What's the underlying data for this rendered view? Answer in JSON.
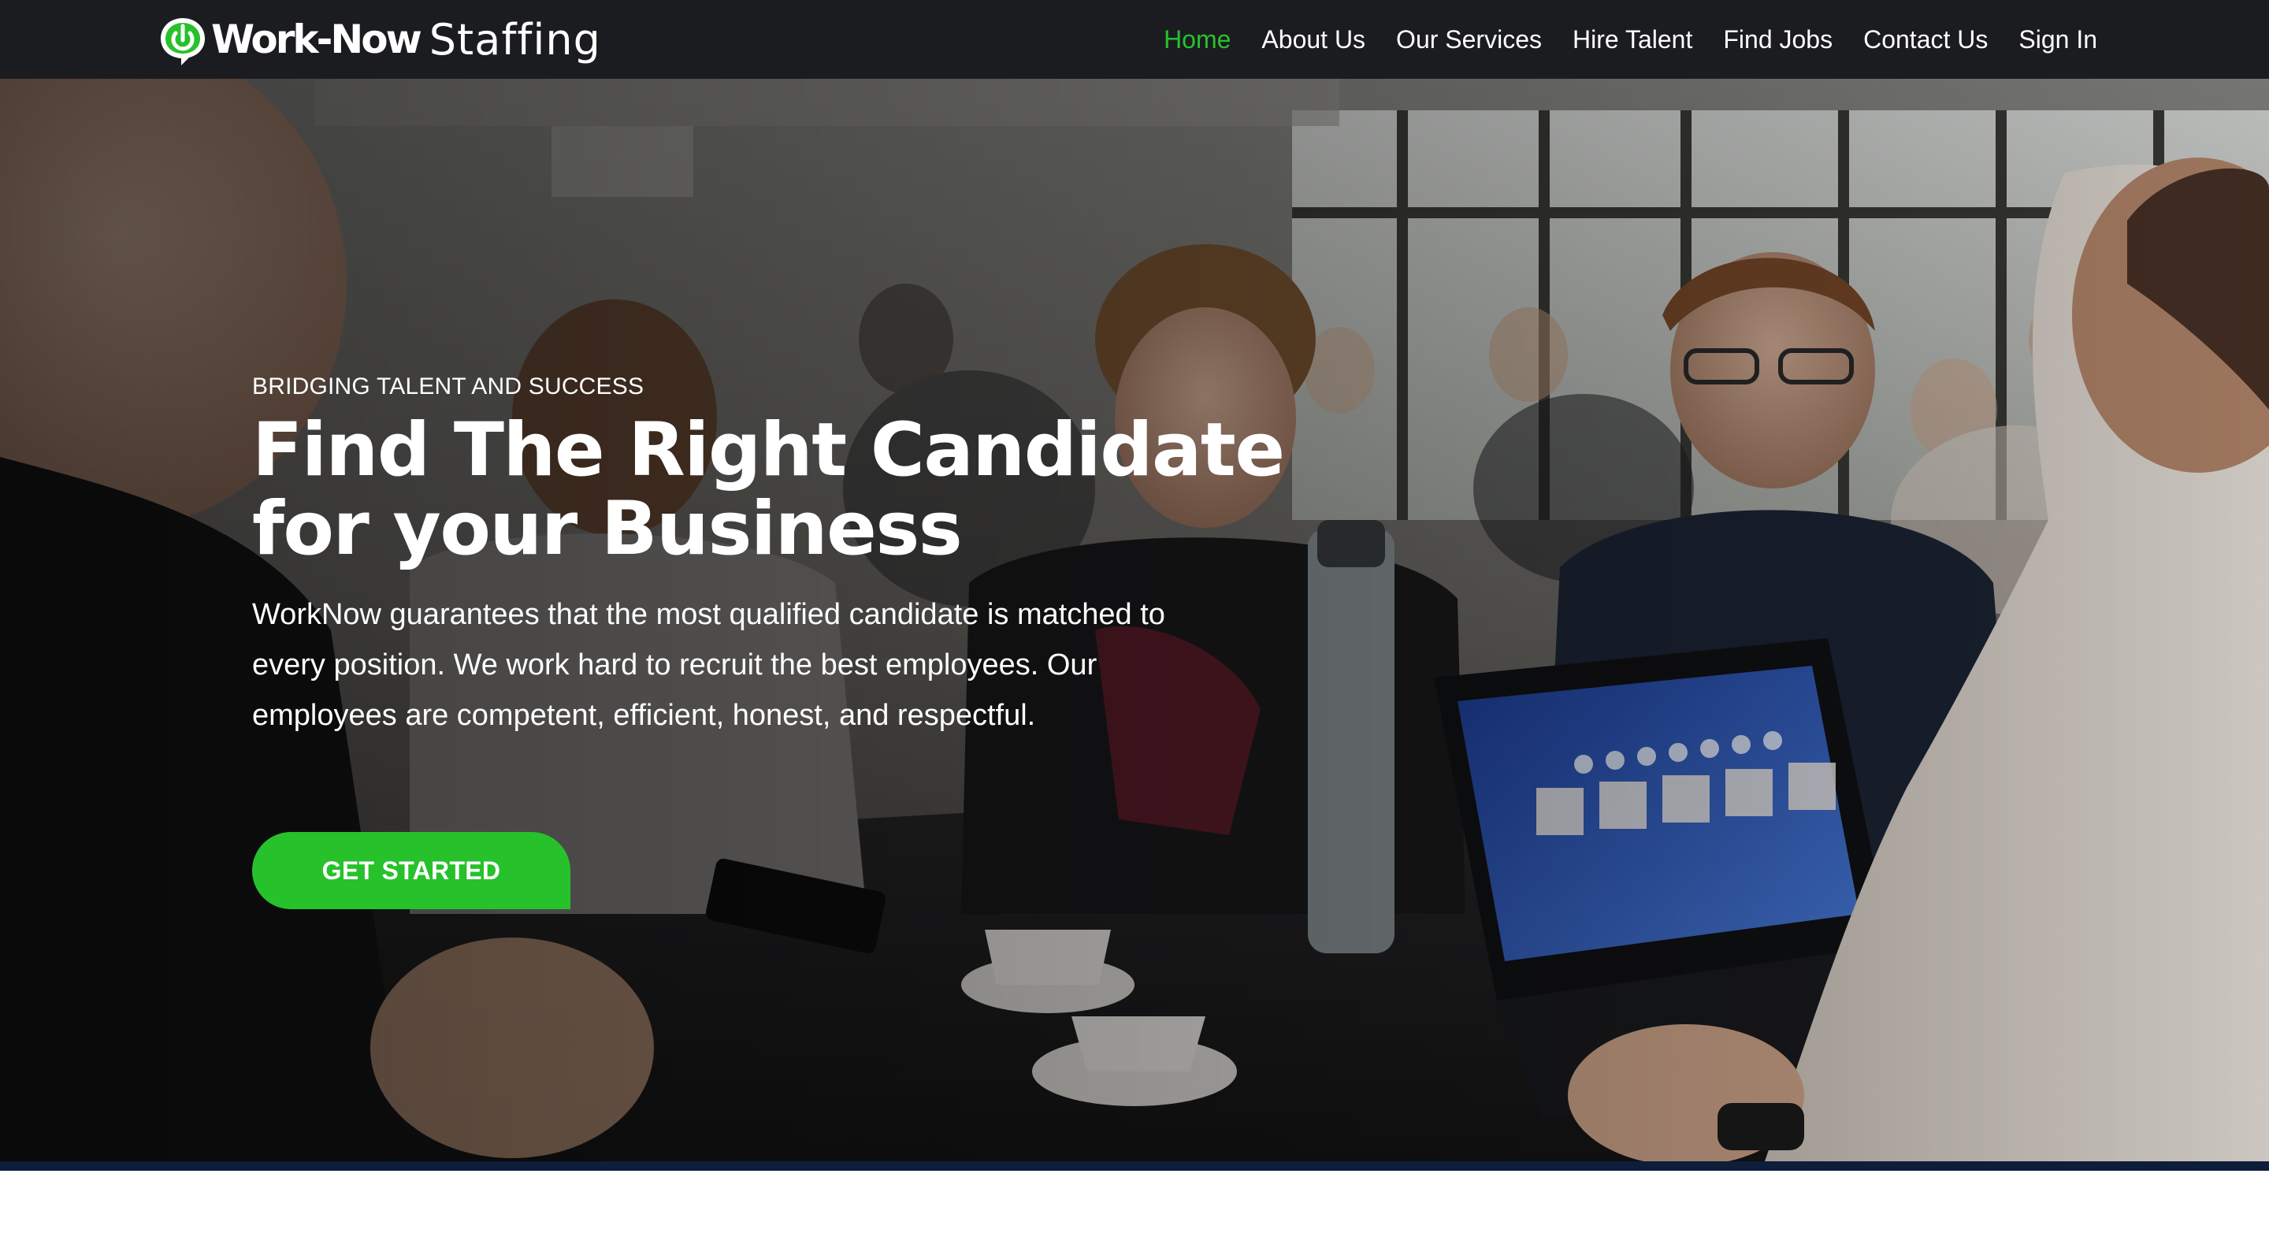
{
  "brand": {
    "name_bold": "Work-Now",
    "name_light": "Staffing",
    "logo_icon": "green-speech-bubble-power-icon",
    "accent_color": "#27c12c"
  },
  "nav": {
    "items": [
      {
        "label": "Home",
        "active": true
      },
      {
        "label": "About Us",
        "active": false
      },
      {
        "label": "Our Services",
        "active": false
      },
      {
        "label": "Hire Talent",
        "active": false
      },
      {
        "label": "Find Jobs",
        "active": false
      },
      {
        "label": "Contact Us",
        "active": false
      },
      {
        "label": "Sign In",
        "active": false
      }
    ]
  },
  "hero": {
    "eyebrow": "BRIDGING TALENT AND SUCCESS",
    "headline_line1": "Find The Right Candidate",
    "headline_line2": "for your Business",
    "lead": "WorkNow guarantees that the most qualified candidate is matched to every position. We work hard to recruit the best employees. Our employees are competent, efficient, honest, and respectful.",
    "cta_label": "GET STARTED",
    "background": "office-meeting-photo"
  }
}
